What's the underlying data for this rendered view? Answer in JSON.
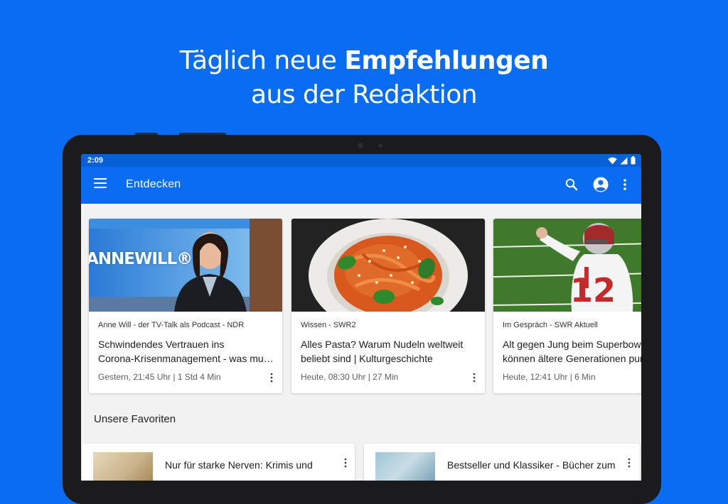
{
  "promo": {
    "line1_regular": "Täglich neue",
    "line1_bold": "Empfehlungen",
    "line2": "aus der Redaktion"
  },
  "status": {
    "time": "2:09"
  },
  "appbar": {
    "title": "Entdecken",
    "icons": [
      "menu-icon",
      "search-icon",
      "account-icon",
      "more-vert-icon"
    ]
  },
  "cards": [
    {
      "source": "Anne Will - der TV-Talk als Podcast - NDR",
      "title": "Schwindendes Vertrauen ins\nCorona-Krisenmanagement - was mu…",
      "meta": "Gestern, 21:45 Uhr | 1 Std 4 Min",
      "image_text": "ANNEWILL®"
    },
    {
      "source": "Wissen - SWR2",
      "title": "Alles Pasta? Warum Nudeln weltweit\nbeliebt sind | Kulturgeschichte",
      "meta": "Heute, 08:30 Uhr | 27 Min"
    },
    {
      "source": "Im Gespräch - SWR Aktuell",
      "title": "Alt gegen Jung beim Superbowl\nkönnen ältere Generationen pun",
      "meta": "Heute, 12:41 Uhr | 6 Min",
      "image_text": "12"
    }
  ],
  "favorites": {
    "section_title": "Unsere Favoriten",
    "items": [
      {
        "title": "Nur für starke Nerven: Krimis und"
      },
      {
        "title": "Bestseller und Klassiker - Bücher zum"
      }
    ]
  },
  "colors": {
    "brand_blue": "#0a6cf2",
    "status_blue": "#0760d6",
    "background": "#f2f2f2"
  }
}
